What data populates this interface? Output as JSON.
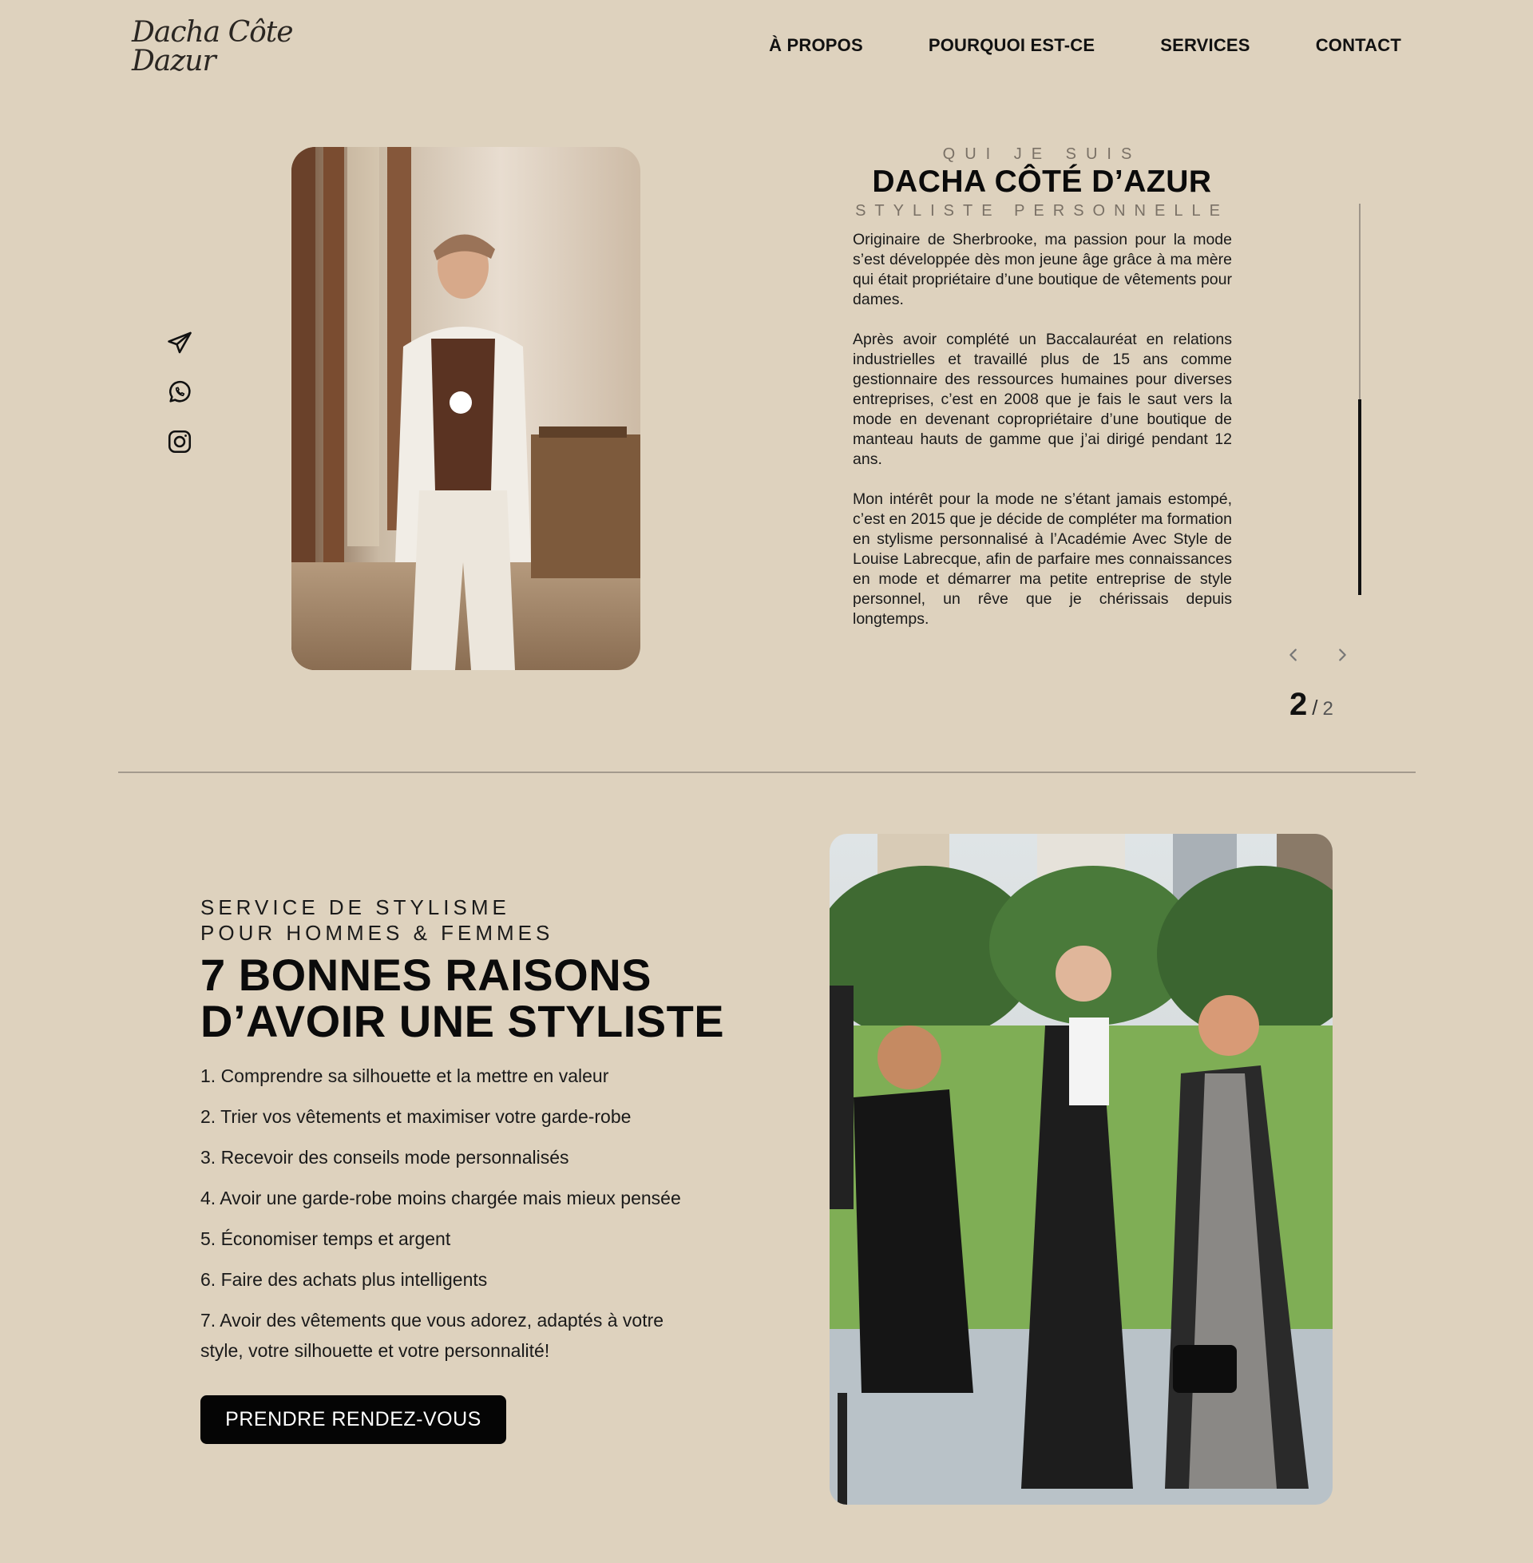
{
  "header": {
    "logo_text": "Dacha Côte Dazur",
    "nav": [
      "À PROPOS",
      "POURQUOI EST-CE",
      "SERVICES",
      "CONTACT"
    ]
  },
  "about": {
    "kicker": "QUI JE SUIS",
    "title": "DACHA CÔTÉ D’AZUR",
    "subtitle": "STYLISTE PERSONNELLE",
    "paragraphs": [
      "Originaire de Sherbrooke, ma passion pour la mode s’est développée dès mon jeune âge grâce à ma mère qui était propriétaire d’une boutique de vêtements pour dames.",
      "Après avoir complété un Baccalauréat en relations industrielles et travaillé plus de 15 ans comme gestionnaire des ressources humaines pour diverses entreprises, c’est en 2008 que je fais le saut vers la mode en devenant copropriétaire d’une boutique de manteau hauts de gamme que j’ai dirigé pendant 12 ans.",
      "Mon intérêt pour la mode ne s’étant jamais estompé, c’est en 2015 que je décide de compléter ma formation en stylisme personnalisé à l’Académie Avec Style de Louise Labrecque, afin de parfaire mes connaissances en mode et démarrer ma petite entreprise de style personnel, un rêve que je chérissais depuis longtemps."
    ],
    "social_icons": [
      "telegram-icon",
      "whatsapp-icon",
      "instagram-icon"
    ],
    "pager": {
      "current": "2",
      "separator": "/",
      "total": "2"
    }
  },
  "services": {
    "kicker_line1": "SERVICE DE STYLISME",
    "kicker_line2": "POUR HOMMES & FEMMES",
    "title_line1": "7 BONNES RAISONS",
    "title_line2": "D’AVOIR UNE STYLISTE",
    "reasons": [
      "1. Comprendre sa silhouette et la mettre en valeur",
      "2. Trier vos vêtements et maximiser votre garde-robe",
      "3. Recevoir des conseils mode personnalisés",
      "4. Avoir une garde-robe moins chargée mais mieux pensée",
      "5. Économiser temps et argent",
      "6. Faire des achats plus intelligents",
      "7. Avoir des vêtements que vous adorez, adaptés à votre style, votre silhouette et votre personnalité!"
    ],
    "cta_label": "PRENDRE RENDEZ-VOUS"
  },
  "colors": {
    "background": "#ded2be",
    "text": "#111111",
    "muted": "#7a7166",
    "button": "#050505"
  }
}
